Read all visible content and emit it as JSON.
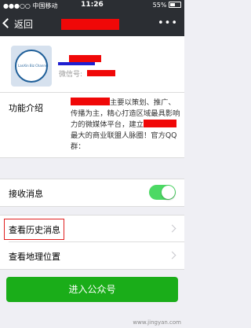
{
  "status_bar": {
    "carrier": "●●●○○ 中国移动 ",
    "time": "11:26",
    "battery": "55%"
  },
  "nav": {
    "back_label": "返回",
    "more_label": "•••"
  },
  "profile": {
    "wechat_id_label": "微信号:",
    "avatar_caption": "LanXin Biz Channel"
  },
  "intro": {
    "label": "功能介绍",
    "text_1": "主要以策划、推广、传播为主，精心打造区域最具影响力的微媒体平台，建立",
    "text_2": "最大的商业联盟人脉圈！官方QQ群："
  },
  "receive": {
    "label": "接收消息",
    "toggle_on": true
  },
  "history": {
    "label": "查看历史消息"
  },
  "location": {
    "label": "查看地理位置"
  },
  "enter_button": {
    "label": "进入公众号"
  },
  "watermark": "www.jingyan.com",
  "colors": {
    "nav_bg": "#2b2e33",
    "accent_green": "#1aad19",
    "toggle_green": "#4cd964",
    "redact": "#f00808"
  }
}
